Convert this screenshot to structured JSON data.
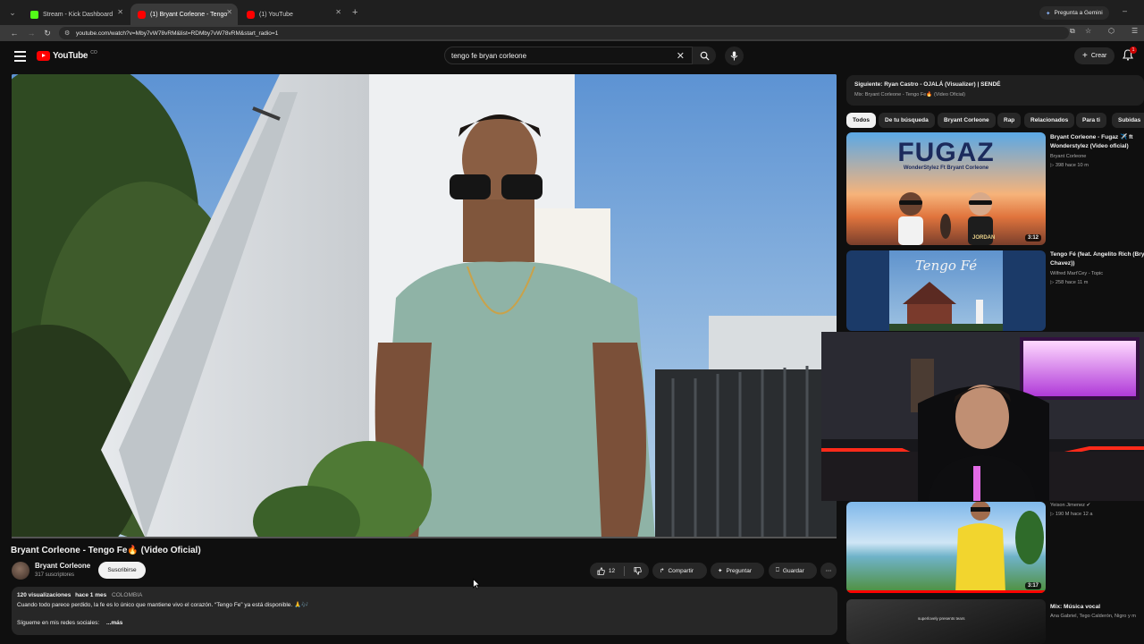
{
  "browser": {
    "tabs": [
      {
        "label": "Stream - Kick Dashboard",
        "active": false,
        "fav_color": "#53fc18"
      },
      {
        "label": "(1) Bryant Corleone - Tengo Fe🔥",
        "active": true,
        "fav_color": "#ff0000"
      },
      {
        "label": "(1) YouTube",
        "active": false,
        "fav_color": "#ff0000"
      }
    ],
    "gemini_label": "Pregunta a Gemini",
    "url": "youtube.com/watch?v=Mby7vW78vRM&list=RDMby7vW78vRM&start_radio=1"
  },
  "header": {
    "logo_text": "YouTube",
    "logo_country": "CO",
    "search_value": "tengo fe bryan corleone",
    "create_label": "Crear",
    "notification_count": "1"
  },
  "video": {
    "title": "Bryant Corleone - Tengo Fe🔥 (Video Oficial)",
    "channel": "Bryant Corleone",
    "subscribers": "317 suscriptores",
    "subscribe_label": "Suscribirse",
    "likes": "12",
    "share_label": "Compartir",
    "ask_label": "Preguntar",
    "save_label": "Guardar",
    "progress": 0.0
  },
  "description": {
    "views": "120 visualizaciones",
    "age": "hace 1 mes",
    "country": "COLOMBIA",
    "text": "Cuando todo parece perdido, la fe es lo único que mantiene vivo el corazón. “Tengo Fe” ya está disponible. 🙏🎶",
    "follow": "Sígueme en mis redes sociales:",
    "more": "...más"
  },
  "up_next": {
    "line1": "Siguiente: Ryan Castro - OJALÁ (Visualizer) | SENDÉ",
    "line2": "Mix: Bryant Corleone - Tengo Fe🔥 (Video Oficial)"
  },
  "chips": [
    "Todos",
    "De tu búsqueda",
    "Bryant Corleone",
    "Rap",
    "Relacionados",
    "Para ti",
    "Subidas"
  ],
  "recommendations": [
    {
      "title1": "Bryant Corleone - Fugaz ✈️ ft",
      "title2": "Wonderstylez (Video oficial)",
      "channel": "Bryant Corleone",
      "meta": "▷ 398  hace 10 m",
      "duration": "3:12",
      "thumb_word": "FUGAZ",
      "thumb_sub": "WonderStylez Ft Bryant Corleone",
      "thumb_caption": "JORDAN"
    },
    {
      "title1": "Tengo Fé (feat. Angelito Rich (Bry",
      "title2": "Chavez))",
      "channel": "Wilfred Mart'Cey - Topic",
      "meta": "▷ 258  hace 11 m",
      "duration": "",
      "thumb_word": "Tengo Fé"
    },
    {
      "title1": "",
      "title2": "",
      "channel": "Yeison Jimenez ✔",
      "meta": "▷ 190 M  hace 12 a",
      "duration": "3:17"
    },
    {
      "title1": "Mix: Música vocal",
      "title2": "",
      "channel": "Ana Gabriel, Tego Calderón, Nigro y m",
      "meta": "",
      "duration": "",
      "thumb_text": "superlovely presents tears"
    }
  ]
}
